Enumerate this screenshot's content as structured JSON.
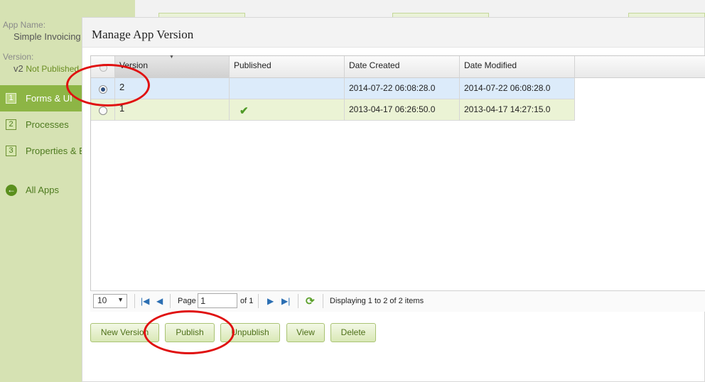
{
  "sidebar": {
    "app_name_label": "App Name:",
    "app_name": "Simple Invoicing",
    "version_label": "Version:",
    "version_value": "v2",
    "version_status": "Not Published",
    "items": [
      {
        "num": "1",
        "label": "Forms & UI"
      },
      {
        "num": "2",
        "label": "Processes"
      },
      {
        "num": "3",
        "label": "Properties & E"
      }
    ],
    "back_label": "All Apps"
  },
  "dialog": {
    "title": "Manage App Version"
  },
  "grid": {
    "columns": [
      "Version",
      "Published",
      "Date Created",
      "Date Modified"
    ],
    "rows": [
      {
        "version": "2",
        "published": "",
        "date_created": "2014-07-22 06:08:28.0",
        "date_modified": "2014-07-22 06:08:28.0",
        "selected": true
      },
      {
        "version": "1",
        "published": "✔",
        "date_created": "2013-04-17 06:26:50.0",
        "date_modified": "2013-04-17 14:27:15.0",
        "selected": false
      }
    ]
  },
  "pager": {
    "page_size": "10",
    "page_label": "Page",
    "page_value": "1",
    "of_label": "of 1",
    "display_text": "Displaying 1 to 2 of 2 items"
  },
  "actions": {
    "new_version": "New Version",
    "publish": "Publish",
    "unpublish": "Unpublish",
    "view": "View",
    "delete": "Delete"
  },
  "colors": {
    "sidebar_bg": "#d6e2b3",
    "nav_active": "#8db545",
    "selected_row": "#dcebfa",
    "alt_row": "#ebf3d5",
    "highlight": "#e01010"
  }
}
